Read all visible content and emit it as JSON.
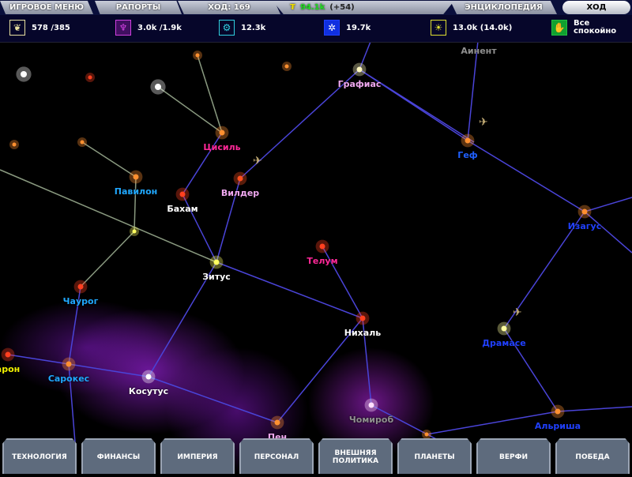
{
  "top": {
    "menu": "ИГРОВОЕ МЕНЮ",
    "reports": "РАПОРТЫ",
    "turn": "ХОД: 169",
    "money": "94.1k",
    "money_delta": "(+54)",
    "encyclopedia": "ЭНЦИКЛОПЕДИЯ",
    "end_turn": "ХОД"
  },
  "resources": [
    {
      "icon": "food-icon",
      "value": "578 /385",
      "color": "#e8e0a0"
    },
    {
      "icon": "minerals-icon",
      "value": "3.0k /1.9k",
      "color": "#d040e0"
    },
    {
      "icon": "industry-icon",
      "value": "12.3k",
      "color": "#30d0e0"
    },
    {
      "icon": "research-icon",
      "value": "19.7k",
      "color": "#2040ff"
    },
    {
      "icon": "trade-icon",
      "value": "13.0k (14.0k)",
      "color": "#e0e030"
    },
    {
      "icon": "morale-icon",
      "value": "Все спокойно",
      "color": "#20c040"
    }
  ],
  "systems": [
    {
      "name": "Графиас",
      "color": "#f0a8f0"
    },
    {
      "name": "Аинент",
      "color": "#909090"
    },
    {
      "name": "Геф",
      "color": "#2060ff"
    },
    {
      "name": "Изагус",
      "color": "#2040ff"
    },
    {
      "name": "Цисиль",
      "color": "#ff2898"
    },
    {
      "name": "Вилдер",
      "color": "#f0a8f0"
    },
    {
      "name": "Павилон",
      "color": "#20a8ff"
    },
    {
      "name": "Бахам",
      "color": "#ffffff"
    },
    {
      "name": "Зитус",
      "color": "#ffffff"
    },
    {
      "name": "Телум",
      "color": "#ff2898"
    },
    {
      "name": "Чаурог",
      "color": "#20a8ff"
    },
    {
      "name": "Нихаль",
      "color": "#ffffff"
    },
    {
      "name": "Драмасе",
      "color": "#2040ff"
    },
    {
      "name": "Сарокес",
      "color": "#20a8ff"
    },
    {
      "name": "Косутус",
      "color": "#ffffff"
    },
    {
      "name": "арон",
      "color": "#f0f000"
    },
    {
      "name": "Чомироб",
      "color": "#909090"
    },
    {
      "name": "Пен",
      "color": "#f0a8f0"
    },
    {
      "name": "Альриша",
      "color": "#2040ff"
    }
  ],
  "bottom": [
    "ТЕХНОЛОГИЯ",
    "ФИНАНСЫ",
    "ИМПЕРИЯ",
    "ПЕРСОНАЛ",
    "ВНЕШНЯЯ ПОЛИТИКА",
    "ПЛАНЕТЫ",
    "ВЕРФИ",
    "ПОБЕДА"
  ]
}
